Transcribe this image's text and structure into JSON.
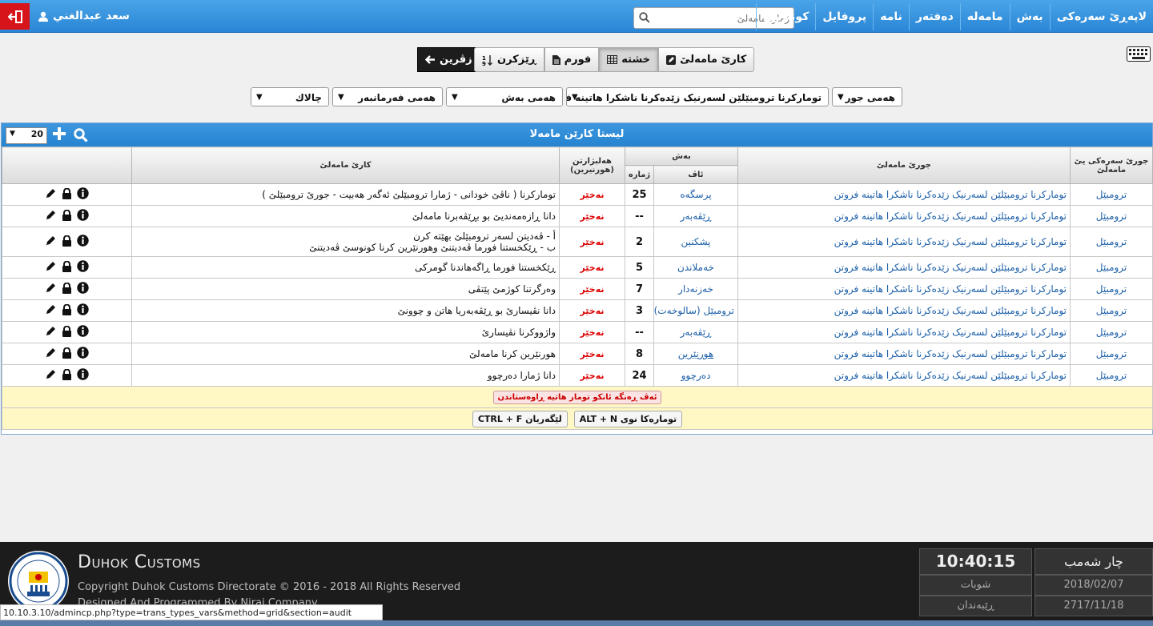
{
  "header": {
    "user_name": "سعد عبدالغني",
    "nav": [
      "لاپەڕێ سەرەکی",
      "بەش",
      "مامەلە",
      "دەفتەر",
      "نامە",
      "پروفایل",
      "کونترول"
    ],
    "search_placeholder": "ژمارا مامەلێ"
  },
  "toolbar": {
    "task_label": "کارێ مامەلێ",
    "grid_label": "خشتە",
    "form_label": "فورم",
    "sort_label": "ڕێزکرن",
    "back_label": "زڤرین"
  },
  "filters": {
    "type": "هەمی جور",
    "kind": "تومارکرنا ترومبێلێن لسەرنیک زێدەکرنا ناشکرا هاتینە فروتن",
    "section": "هەمی بەش",
    "employee": "هەمی فەرمانبەر",
    "print": "چالاك"
  },
  "panel": {
    "title": "لیستا کارێن مامەلا",
    "page_size": "20",
    "headers": {
      "type": "جورێ سەرەکی یێ مامەلێ",
      "kind": "جورێ مامەلێ",
      "section": "بەش",
      "place": "ئاڤ",
      "number": "ژمارە",
      "optional": "هەلبژارتن (هورنیرین)",
      "work": "کارێ مامەلێ"
    },
    "rows": [
      {
        "type": "ترومبێل",
        "kind": "تومارکرنا ترومبێلێن لسەرنیک زێدەکرنا ناشکرا هاتینە فروتن",
        "place": "پرسگەه",
        "number": "25",
        "optional": "نەخێر",
        "work": "تومارکرنا ( ناڤێ خودانی - ژمارا ترومبێلێ ئەگەر هەبیت - جورێ ترومبێلێ )"
      },
      {
        "type": "ترومبێل",
        "kind": "تومارکرنا ترومبێلێن لسەرنیک زێدەکرنا ناشکرا هاتینە فروتن",
        "place": "ڕێڤەبەر",
        "number": "--",
        "optional": "نەخێر",
        "work": "دانا ڕازەمەندیێ بو بڕێڤەبرنا مامەلێ"
      },
      {
        "type": "ترومبێل",
        "kind": "تومارکرنا ترومبێلێن لسەرنیک زێدەکرنا ناشکرا هاتینە فروتن",
        "place": "پشکنین",
        "number": "2",
        "optional": "نەخێر",
        "work": "أ - ڤەدیتن لسەر ترومبێلێ بهێتە کرن",
        "work2": "ب - ڕێکخستنا فورما ڤەدیتنێ وهورنێرین کرنا کونوسێ ڤەدیتنێ"
      },
      {
        "type": "ترومبێل",
        "kind": "تومارکرنا ترومبێلێن لسەرنیک زێدەکرنا ناشکرا هاتینە فروتن",
        "place": "خەملاندن",
        "number": "5",
        "optional": "نەخێر",
        "work": "ڕێکخستنا فورما ڕاگەهاندنا گومرکی"
      },
      {
        "type": "ترومبێل",
        "kind": "تومارکرنا ترومبێلێن لسەرنیک زێدەکرنا ناشکرا هاتینە فروتن",
        "place": "خەزنەدار",
        "number": "7",
        "optional": "نەخێر",
        "work": "وەرگرتنا کوژمێ پێتڤی"
      },
      {
        "type": "ترومبێل",
        "kind": "تومارکرنا ترومبێلێن لسەرنیک زێدەکرنا ناشکرا هاتینە فروتن",
        "place": "ترومبێل (سالوخەت)",
        "number": "3",
        "optional": "نەخێر",
        "work": "دانا نڤیسارێ بو ڕێڤەبەریا هاتن و چوونێ"
      },
      {
        "type": "ترومبێل",
        "kind": "تومارکرنا ترومبێلێن لسەرنیک زێدەکرنا ناشکرا هاتینە فروتن",
        "place": "ڕێڤەبەر",
        "number": "--",
        "optional": "نەخێر",
        "work": "واژووکرنا نڤیسارێ"
      },
      {
        "type": "ترومبێل",
        "kind": "تومارکرنا ترومبێلێن لسەرنیک زێدەکرنا ناشکرا هاتینە فروتن",
        "place": "هورنێرین",
        "number": "8",
        "optional": "نەخێر",
        "work": "هورنێرین کرنا مامەلێ"
      },
      {
        "type": "ترومبێل",
        "kind": "تومارکرنا ترومبێلێن لسەرنیک زێدەکرنا ناشکرا هاتینە فروتن",
        "place": "دەرچوو",
        "number": "24",
        "optional": "نەخێر",
        "work": "دانا ژمارا دەرچوو"
      }
    ],
    "notice": "ئەڤ ڕەنگە ئانکو تومار هاتیە ڕاوەستاندن",
    "shortcut_new": "ALT + N",
    "shortcut_new_label": "تومارەکا نوی",
    "shortcut_find": "CTRL + F",
    "shortcut_find_label": "لێگەریان"
  },
  "footer": {
    "brand": "Duhok Customs",
    "copyright": "Copyright Duhok Customs Directorate © 2016 - 2018 All Rights Reserved",
    "designed": "Designed And Programmed By Nirai Company",
    "time": "10:40:15",
    "day": "چار شەمب",
    "month": "شوبات",
    "date": "2018/02/07",
    "kurdish_label": "ڕێبەندان",
    "kurdish_date": "2717/11/18"
  },
  "status_url": "10.10.3.10/admincp.php?type=trans_types_vars&method=grid&section=audit"
}
